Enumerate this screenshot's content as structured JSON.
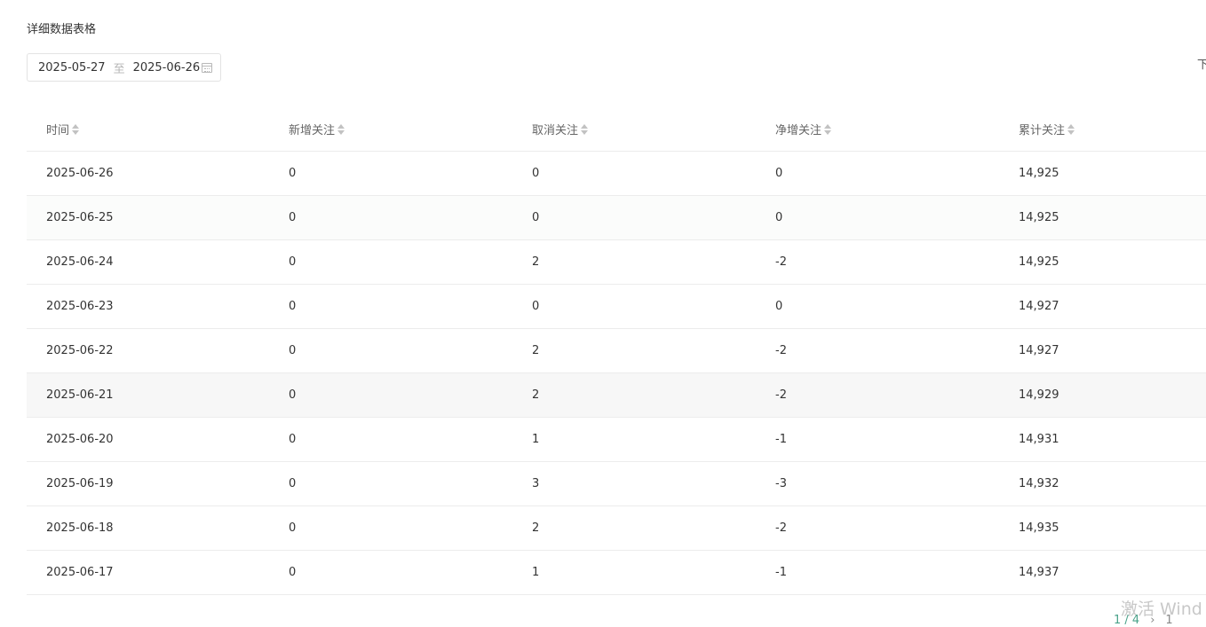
{
  "section": {
    "title": "详细数据表格"
  },
  "date_range": {
    "start": "2025-05-27",
    "separator": "至",
    "end": "2025-06-26"
  },
  "toolbar": {
    "download_label": "下"
  },
  "table": {
    "columns": [
      "时间",
      "新增关注",
      "取消关注",
      "净增关注",
      "累计关注"
    ],
    "rows": [
      [
        "2025-06-26",
        "0",
        "0",
        "0",
        "14,925"
      ],
      [
        "2025-06-25",
        "0",
        "0",
        "0",
        "14,925"
      ],
      [
        "2025-06-24",
        "0",
        "2",
        "-2",
        "14,925"
      ],
      [
        "2025-06-23",
        "0",
        "0",
        "0",
        "14,927"
      ],
      [
        "2025-06-22",
        "0",
        "2",
        "-2",
        "14,927"
      ],
      [
        "2025-06-21",
        "0",
        "2",
        "-2",
        "14,929"
      ],
      [
        "2025-06-20",
        "0",
        "1",
        "-1",
        "14,931"
      ],
      [
        "2025-06-19",
        "0",
        "3",
        "-3",
        "14,932"
      ],
      [
        "2025-06-18",
        "0",
        "2",
        "-2",
        "14,935"
      ],
      [
        "2025-06-17",
        "0",
        "1",
        "-1",
        "14,937"
      ]
    ]
  },
  "pagination": {
    "label": "1 / 4",
    "next": "›",
    "goto": "1"
  },
  "watermark": {
    "text": "激活 Wind"
  }
}
